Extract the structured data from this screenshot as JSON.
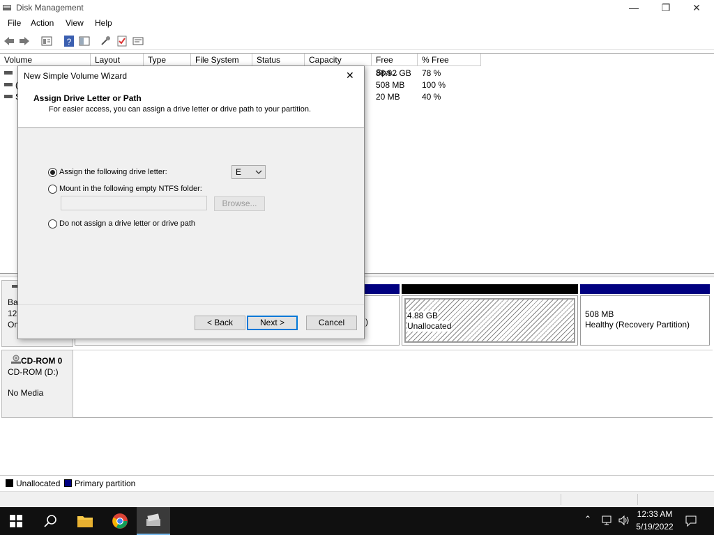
{
  "window": {
    "title": "Disk Management",
    "minimize_label": "—",
    "restore_label": "❐",
    "close_label": "✕"
  },
  "menu": [
    "File",
    "Action",
    "View",
    "Help"
  ],
  "toolbar_icons": [
    "back-arrow-icon",
    "forward-arrow-icon",
    "properties-icon",
    "help-icon",
    "show-hide-icon",
    "connect-icon",
    "checklist-icon",
    "settings-icon"
  ],
  "volume_table": {
    "columns": [
      "Volume",
      "Layout",
      "Type",
      "File System",
      "Status",
      "Capacity",
      "Free Spa...",
      "% Free"
    ],
    "rows": [
      {
        "volume": "",
        "free_space": "88.92 GB",
        "pct_free": "78 %"
      },
      {
        "volume": "(",
        "free_space": "508 MB",
        "pct_free": "100 %"
      },
      {
        "volume": "S",
        "free_space": "20 MB",
        "pct_free": "40 %"
      }
    ]
  },
  "disk0": {
    "label_line1": "Ba",
    "label_line2": "12(",
    "label_line3": "On",
    "partial_text": ")",
    "unallocated_size": "4.88 GB",
    "unallocated_label": "Unallocated",
    "recovery_size": "508 MB",
    "recovery_label": "Healthy (Recovery Partition)"
  },
  "cdrom": {
    "name": "CD-ROM 0",
    "drive": "CD-ROM (D:)",
    "media": "No Media"
  },
  "legend": {
    "unallocated": "Unallocated",
    "primary": "Primary partition"
  },
  "colors": {
    "unallocated": "#000000",
    "primary": "#000080",
    "accent": "#0078d7"
  },
  "dialog": {
    "title": "New Simple Volume Wizard",
    "heading": "Assign Drive Letter or Path",
    "subheading": "For easier access, you can assign a drive letter or drive path to your partition.",
    "option_letter": "Assign the following drive letter:",
    "option_folder": "Mount in the following empty NTFS folder:",
    "option_none": "Do not assign a drive letter or drive path",
    "drive_letter": "E",
    "browse_label": "Browse...",
    "folder_value": "",
    "back_label": "< Back",
    "next_label": "Next >",
    "cancel_label": "Cancel",
    "close_label": "✕"
  },
  "tray": {
    "time": "12:33 AM",
    "date": "5/19/2022"
  }
}
